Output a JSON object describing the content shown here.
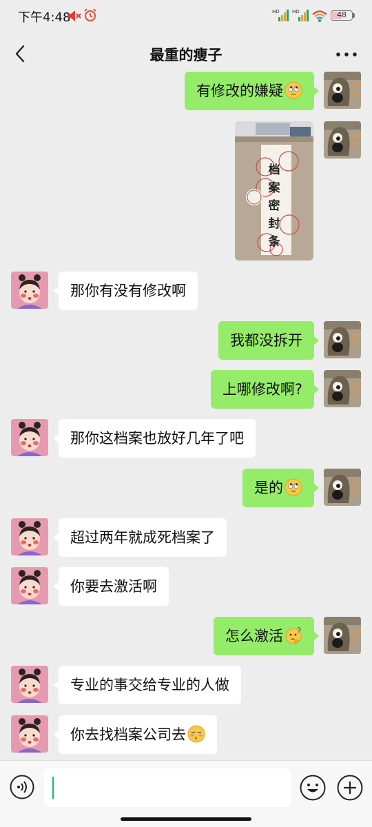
{
  "status_bar": {
    "time": "下午4:48",
    "battery": "48",
    "battery_level": 0.48,
    "signal_labels": [
      "HD",
      "HD"
    ]
  },
  "header": {
    "title": "最重的瘦子"
  },
  "messages": [
    {
      "side": "out",
      "type": "text",
      "text": "有修改的嫌疑",
      "emoji": "eyes-rolling-face-emoji"
    },
    {
      "side": "out",
      "type": "image",
      "image_text": [
        "档",
        "案",
        "密",
        "封",
        "条"
      ]
    },
    {
      "side": "in",
      "type": "text",
      "text": "那你有没有修改啊"
    },
    {
      "side": "out",
      "type": "text",
      "text": "我都没拆开"
    },
    {
      "side": "out",
      "type": "text",
      "text": "上哪修改啊?"
    },
    {
      "side": "in",
      "type": "text",
      "text": "那你这档案也放好几年了吧"
    },
    {
      "side": "out",
      "type": "text",
      "text": "是的",
      "emoji": "eyes-rolling-face-emoji"
    },
    {
      "side": "in",
      "type": "text",
      "text": "超过两年就成死档案了"
    },
    {
      "side": "in",
      "type": "text",
      "text": "你要去激活啊"
    },
    {
      "side": "out",
      "type": "text",
      "text": "怎么激活",
      "emoji": "thinking-face-emoji"
    },
    {
      "side": "in",
      "type": "text",
      "text": "专业的事交给专业的人做"
    },
    {
      "side": "in",
      "type": "text",
      "text": "你去找档案公司去",
      "emoji": "kissing-face-emoji"
    }
  ],
  "input_bar": {
    "voice_icon": "voice-icon",
    "emoji_icon": "smiley-icon",
    "plus_icon": "plus-icon",
    "input_value": ""
  },
  "colors": {
    "background": "#ededed",
    "outgoing_bubble": "#95ec69",
    "incoming_bubble": "#ffffff",
    "cursor": "#07c160"
  }
}
